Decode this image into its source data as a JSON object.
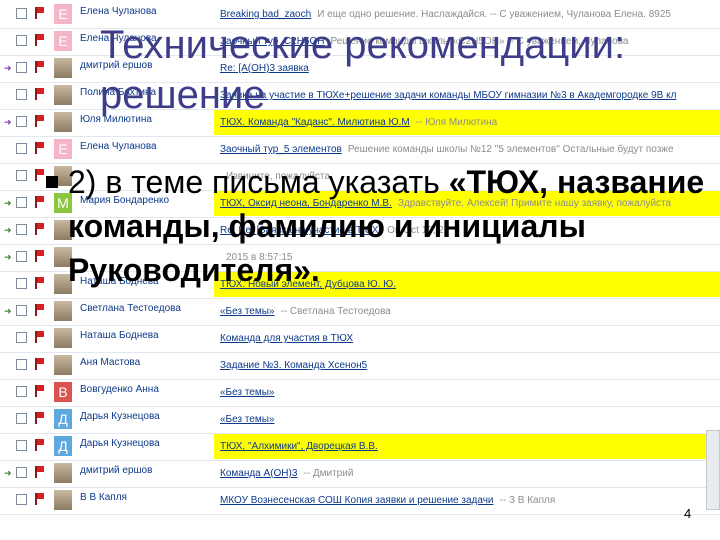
{
  "slide": {
    "title": "Технические рекомендации: решение",
    "bullet_lead": "2) в теме письма указать ",
    "bullet_bold": "«ТЮХ, название команды, фамилию и инициалы Руководителя».",
    "page_number": "4"
  },
  "mail": {
    "rows": [
      {
        "arrow": "",
        "avatar": "Е",
        "avatar_color": "#f4b6c6",
        "sender": "Елена Чуланова",
        "subject": "Breaking bad_zaoch",
        "preview": "И еще одно решение. Наслаждайся. -- С уважением, Чуланова Елена. 8925",
        "hl": false
      },
      {
        "arrow": "",
        "avatar": "Е",
        "avatar_color": "#f4b6c6",
        "sender": "Елена Чуланова",
        "subject": "Заочный тур_C2H5OH",
        "preview": "Решение команды школы «С2Н5ОН» -- С уважением, Чуланова",
        "hl": false
      },
      {
        "arrow": "purple",
        "avatar": "",
        "avatar_color": "photo",
        "sender": "дмитрий ершов",
        "subject": "Re: [A(OH)3 заявка",
        "preview": "",
        "hl": false
      },
      {
        "arrow": "",
        "avatar": "",
        "avatar_color": "photo",
        "sender": "Полина Бахтина",
        "subject": "Заявка на участие в ТЮХе+решение задачи команды МБОУ гимназии №3 в Академгородке 9В кл",
        "preview": "",
        "hl": false
      },
      {
        "arrow": "purple",
        "avatar": "",
        "avatar_color": "photo",
        "sender": "Юля Милютина",
        "subject": "ТЮХ. Команда \"Каданс\". Милютина Ю.М",
        "preview": "-- Юля Милютина",
        "hl": true
      },
      {
        "arrow": "",
        "avatar": "Е",
        "avatar_color": "#f4b6c6",
        "sender": "Елена Чуланова",
        "subject": "Заочный тур_5 элементов",
        "preview": "Решение команды школы №12 \"5 элементов\" Остальные будут позже",
        "hl": false
      },
      {
        "arrow": "",
        "avatar": "",
        "avatar_color": "photo",
        "sender": "",
        "subject": "",
        "preview": "Извините, пожалуйста",
        "hl": false
      },
      {
        "arrow": "green",
        "avatar": "М",
        "avatar_color": "#8cc63f",
        "sender": "Мария Бондаренко",
        "subject": "ТЮХ, Оксид неона, Бондаренко М.В.",
        "preview": "Здравствуйте, Алексей! Примите нашу заявку, пожалуйста",
        "hl": true
      },
      {
        "arrow": "green",
        "avatar": "",
        "avatar_color": "photo",
        "sender": "",
        "subject": "Re: Re: [Заявка на участие в ТЮХ]",
        "preview": "On Oct 12, 2",
        "hl": false
      },
      {
        "arrow": "green",
        "avatar": "",
        "avatar_color": "photo",
        "sender": "",
        "subject": "",
        "preview": "2015 в 8:57:15",
        "hl": false
      },
      {
        "arrow": "",
        "avatar": "",
        "avatar_color": "photo",
        "sender": "Наташа Боднева",
        "subject": "ТЮХ. Новый элемент, Дубцова Ю. Ю.",
        "preview": "",
        "hl": true
      },
      {
        "arrow": "green",
        "avatar": "",
        "avatar_color": "photo",
        "sender": "Светлана Тестоедова",
        "subject": "«Без темы»",
        "preview": "-- Светлана Тестоедова",
        "hl": false
      },
      {
        "arrow": "",
        "avatar": "",
        "avatar_color": "photo",
        "sender": "Наташа Боднева",
        "subject": "Команда для участия в ТЮХ",
        "preview": "",
        "hl": false
      },
      {
        "arrow": "",
        "avatar": "",
        "avatar_color": "photo",
        "sender": "Аня Мастова",
        "subject": "Задание №3. Команда Хсенон5",
        "preview": "",
        "hl": false
      },
      {
        "arrow": "",
        "avatar": "В",
        "avatar_color": "#d9534f",
        "sender": "Вовгуденко Анна",
        "subject": "«Без темы»",
        "preview": "",
        "hl": false
      },
      {
        "arrow": "",
        "avatar": "Д",
        "avatar_color": "#5fa8dd",
        "sender": "Дарья Кузнецова",
        "subject": "«Без темы»",
        "preview": "",
        "hl": false
      },
      {
        "arrow": "",
        "avatar": "Д",
        "avatar_color": "#5fa8dd",
        "sender": "Дарья Кузнецова",
        "subject": "ТЮХ, \"Алхимики\", Дворецкая В.В.",
        "preview": "",
        "hl": true
      },
      {
        "arrow": "green",
        "avatar": "",
        "avatar_color": "photo",
        "sender": "дмитрий ершов",
        "subject": "Команда А(ОН)3",
        "preview": "-- Дмитрий",
        "hl": false
      },
      {
        "arrow": "",
        "avatar": "",
        "avatar_color": "photo",
        "sender": "В В Капля",
        "subject": "МКОУ Вознесенская СОШ Копия заявки и решение задачи",
        "preview": "-- З В Капля",
        "hl": false
      }
    ]
  }
}
